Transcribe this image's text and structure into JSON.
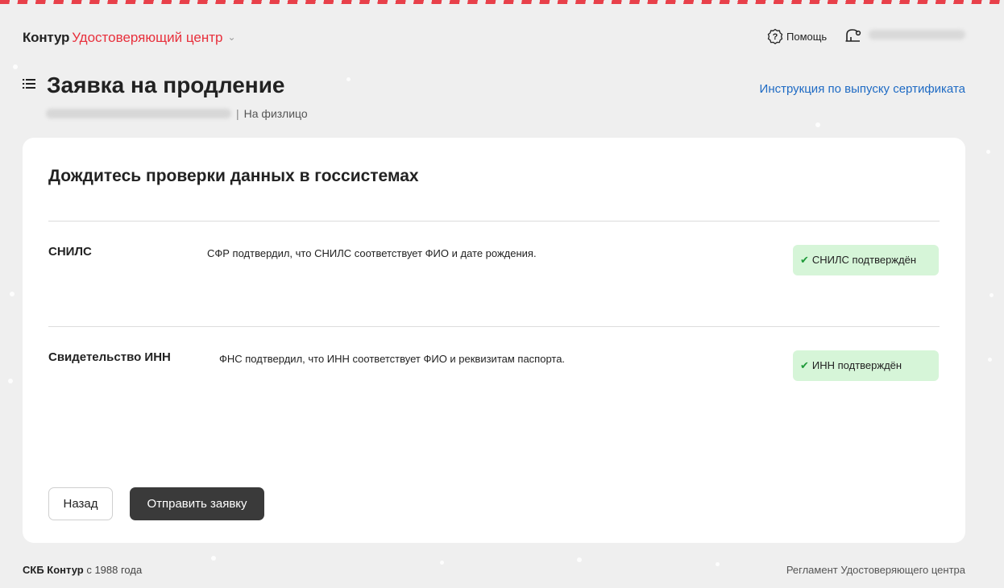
{
  "header": {
    "brand": "Контур",
    "product": "Удостоверяющий центр",
    "help_label": "Помощь"
  },
  "page": {
    "title": "Заявка на продление",
    "subtitle_type": "На физлицо",
    "instruction_link": "Инструкция по выпуску сертификата"
  },
  "card": {
    "title": "Дождитесь проверки данных в госсистемах",
    "rows": [
      {
        "label": "СНИЛС",
        "description": "СФР подтвердил, что СНИЛС соответствует ФИО и дате рождения.",
        "status": "СНИЛС подтверждён"
      },
      {
        "label": "Свидетельство ИНН",
        "description": "ФНС подтвердил, что ИНН соответствует ФИО и реквизитам паспорта.",
        "status": "ИНН подтверждён"
      }
    ],
    "back_button": "Назад",
    "submit_button": "Отправить заявку"
  },
  "footer": {
    "company": "СКБ Контур",
    "since": "с 1988 года",
    "regulation_link": "Регламент Удостоверяющего центра"
  },
  "colors": {
    "accent_red": "#e8303c",
    "link_blue": "#1f6bc4",
    "success_bg": "#d6f5d8",
    "success_check": "#1f9a3a",
    "primary_button": "#3a3a3a",
    "background": "#efefef"
  }
}
